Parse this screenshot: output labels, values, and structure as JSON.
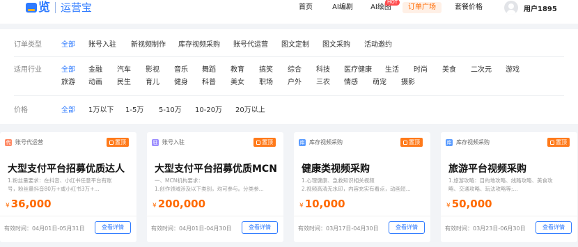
{
  "header": {
    "logo_char": "览",
    "logo_text": "运营宝",
    "nav": [
      {
        "label": "首页",
        "active": false,
        "badge": ""
      },
      {
        "label": "AI编剧",
        "active": false,
        "badge": ""
      },
      {
        "label": "AI绘图",
        "active": false,
        "badge": "HOT"
      },
      {
        "label": "订单广场",
        "active": true,
        "badge": ""
      },
      {
        "label": "套餐价格",
        "active": false,
        "badge": ""
      }
    ],
    "user_name": "用户1895"
  },
  "filters": {
    "order_type": {
      "label": "订单类型",
      "options": [
        "全部",
        "账号入驻",
        "新视频制作",
        "库存视频采购",
        "账号代运营",
        "图文定制",
        "图文采购",
        "活动邀约"
      ]
    },
    "industry": {
      "label": "适用行业",
      "options_row1": [
        "全部",
        "金融",
        "汽车",
        "影视",
        "音乐",
        "舞蹈",
        "教育",
        "搞笑",
        "综合",
        "科技",
        "医疗健康",
        "生活",
        "时尚",
        "美食",
        "二次元",
        "游戏"
      ],
      "options_row2": [
        "旅游",
        "动画",
        "民生",
        "育儿",
        "健身",
        "科普",
        "美女",
        "职场",
        "户外",
        "三农",
        "情感",
        "萌宠",
        "摄影"
      ]
    },
    "price": {
      "label": "价格",
      "options": [
        "全部",
        "1万以下",
        "1-5万",
        "5-10万",
        "10-20万",
        "20万以上"
      ]
    }
  },
  "cards": [
    {
      "type": "账号代运营",
      "type_icon": "代",
      "type_color": "#ff8a65",
      "pin": "置顶",
      "title": "大型支付平台招募优质达人",
      "desc1": "1.粉丝量要求：在抖音、小红书任意平台有账",
      "desc2": "号，粉丝量抖音80万+或小红书3万+...",
      "price": "36,000",
      "currency": "¥",
      "period": "有效时间：04月01日-05月31日",
      "button": "查看详情"
    },
    {
      "type": "账号入驻",
      "type_icon": "驻",
      "type_color": "#9b8cff",
      "pin": "置顶",
      "title": "大型支付平台招募优质MCN",
      "desc1": "一、MCN机构要求：",
      "desc2": "1.创作领域涉及以下类别，均可参与。分类参...",
      "price": "200,000",
      "currency": "¥",
      "period": "有效时间：04月01日-04月30日",
      "button": "查看详情"
    },
    {
      "type": "库存视频采购",
      "type_icon": "库",
      "type_color": "#5b9cff",
      "pin": "置顶",
      "title": "健康类视频采购",
      "desc1": "1.心理健康、急救知识相关视频",
      "desc2": "2.视频高清无水印，内容充实有看点，动画短...",
      "price": "10,000",
      "currency": "¥",
      "period": "有效时间：03月17日-04月30日",
      "button": "查看详情"
    },
    {
      "type": "库存视频采购",
      "type_icon": "库",
      "type_color": "#5b9cff",
      "pin": "置顶",
      "title": "旅游平台视频采购",
      "desc1": "1.旅游攻略：目的地攻略、线路攻略、美食攻",
      "desc2": "略、交通攻略、玩法攻略等;...",
      "price": "50,000",
      "currency": "¥",
      "period": "有效时间：03月23日-06月30日",
      "button": "查看详情"
    }
  ]
}
